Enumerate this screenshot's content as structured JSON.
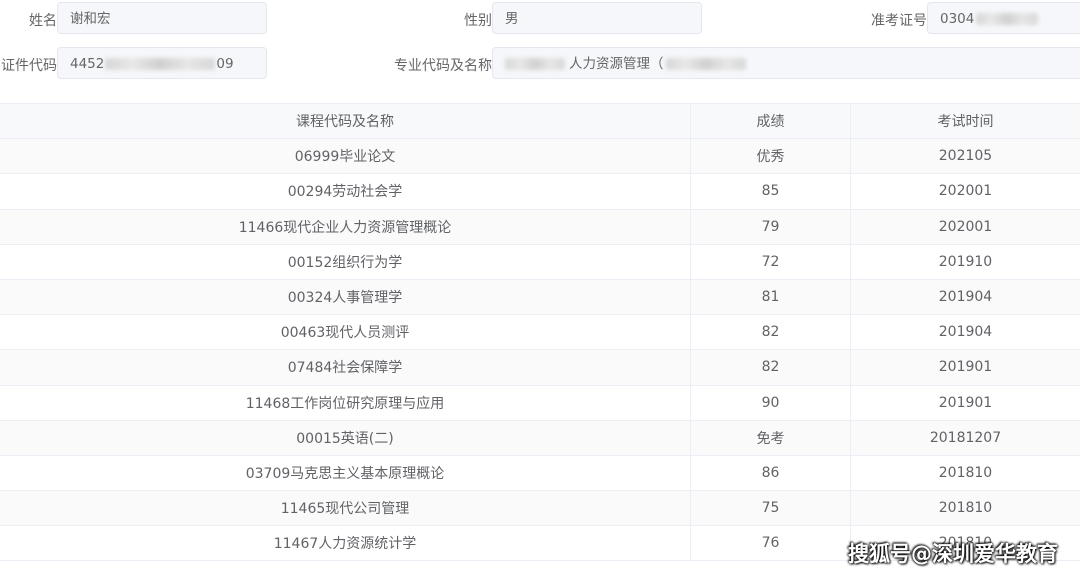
{
  "form": {
    "name_label": "姓名",
    "name_value": "谢和宏",
    "gender_label": "性别",
    "gender_value": "男",
    "ticket_label": "准考证号",
    "ticket_value_visible": "0304",
    "id_label": "证件代码",
    "id_value_visible_prefix": "4452",
    "id_value_visible_suffix": "09",
    "major_label": "专业代码及名称",
    "major_value_visible": "人力资源管理（"
  },
  "table": {
    "headers": {
      "course": "课程代码及名称",
      "score": "成绩",
      "time": "考试时间"
    },
    "rows": [
      {
        "course": "06999毕业论文",
        "score": "优秀",
        "time": "202105"
      },
      {
        "course": "00294劳动社会学",
        "score": "85",
        "time": "202001"
      },
      {
        "course": "11466现代企业人力资源管理概论",
        "score": "79",
        "time": "202001"
      },
      {
        "course": "00152组织行为学",
        "score": "72",
        "time": "201910"
      },
      {
        "course": "00324人事管理学",
        "score": "81",
        "time": "201904"
      },
      {
        "course": "00463现代人员测评",
        "score": "82",
        "time": "201904"
      },
      {
        "course": "07484社会保障学",
        "score": "82",
        "time": "201901"
      },
      {
        "course": "11468工作岗位研究原理与应用",
        "score": "90",
        "time": "201901"
      },
      {
        "course": "00015英语(二)",
        "score": "免考",
        "time": "20181207"
      },
      {
        "course": "03709马克思主义基本原理概论",
        "score": "86",
        "time": "201810"
      },
      {
        "course": "11465现代公司管理",
        "score": "75",
        "time": "201810"
      },
      {
        "course": "11467人力资源统计学",
        "score": "76",
        "time": "201810"
      }
    ]
  },
  "watermark": "搜狐号@深圳爱华教育"
}
